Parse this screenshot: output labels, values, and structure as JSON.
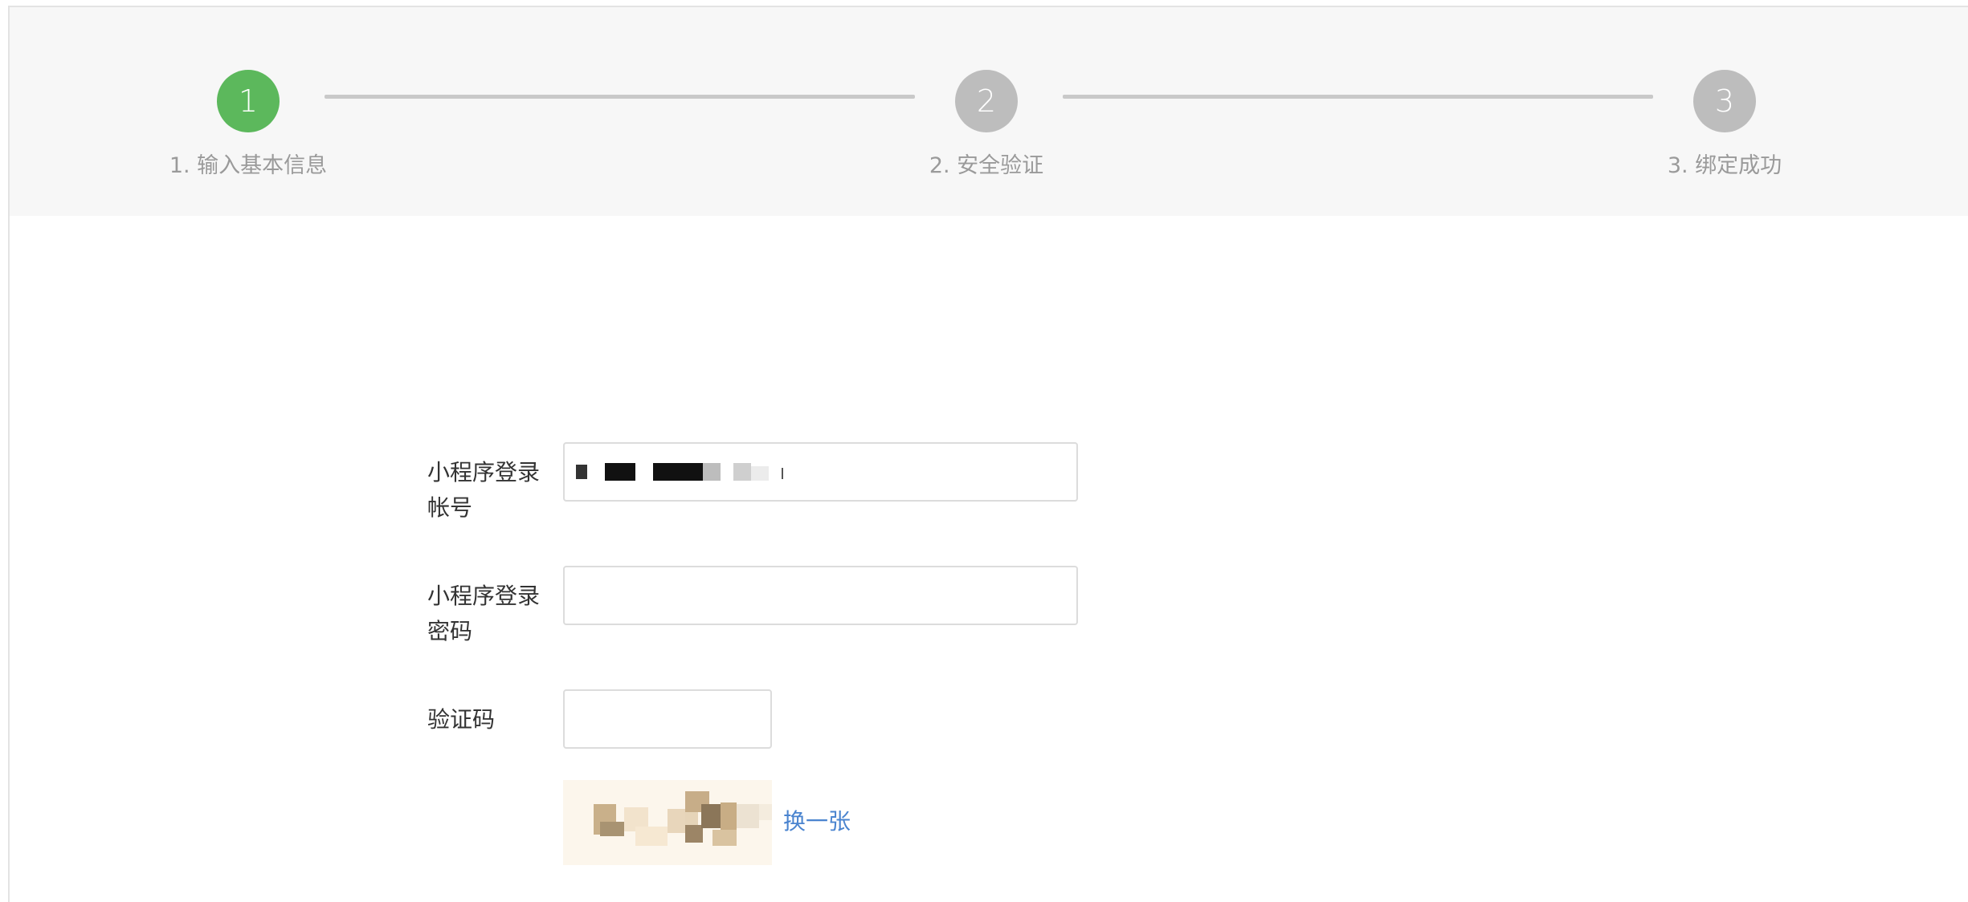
{
  "steps": [
    {
      "number": "1",
      "label": "1. 输入基本信息",
      "state": "active"
    },
    {
      "number": "2",
      "label": "2. 安全验证",
      "state": "inactive"
    },
    {
      "number": "3",
      "label": "3. 绑定成功",
      "state": "inactive"
    }
  ],
  "form": {
    "account_label_line1": "小程序登录",
    "account_label_line2": "帐号",
    "account_value": "",
    "password_label_line1": "小程序登录",
    "password_label_line2": "密码",
    "password_value": "",
    "captcha_label": "验证码",
    "captcha_value": "",
    "refresh_captcha_label": "换一张"
  },
  "colors": {
    "step_active": "#5cb85c",
    "step_inactive": "#bdbdbd",
    "link": "#4a84cf",
    "header_bg": "#f7f7f7"
  }
}
